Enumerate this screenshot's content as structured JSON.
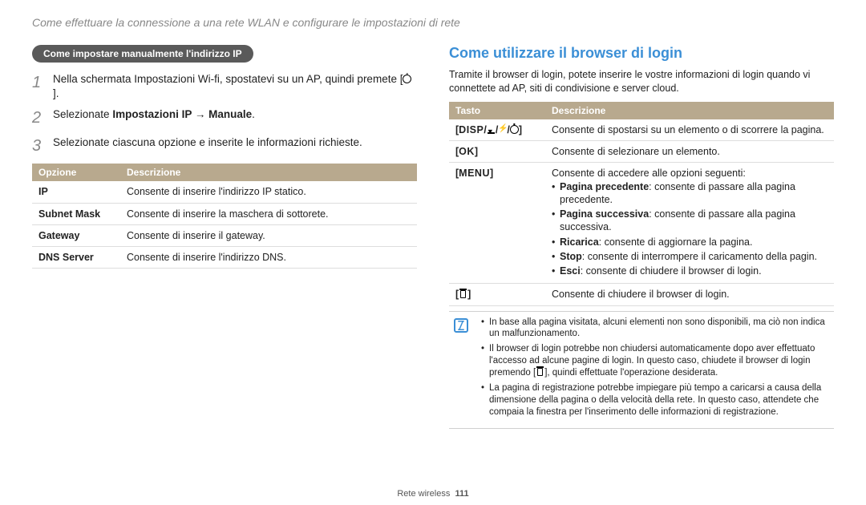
{
  "chapter_title": "Come effettuare la connessione a una rete WLAN e configurare le impostazioni di rete",
  "left": {
    "subheading": "Come impostare manualmente l'indirizzo IP",
    "step1_a": "Nella schermata Impostazioni Wi-fi, spostatevi su un AP, quindi premete [",
    "step1_b": "].",
    "step2_a": "Selezionate ",
    "step2_b": "Impostazioni IP → Manuale",
    "step2_c": ".",
    "step3": "Selezionate ciascuna opzione e inserite le informazioni richieste.",
    "table_h1": "Opzione",
    "table_h2": "Descrizione",
    "rows": [
      {
        "k": "IP",
        "v": "Consente di inserire l'indirizzo IP statico."
      },
      {
        "k": "Subnet Mask",
        "v": "Consente di inserire la maschera di sottorete."
      },
      {
        "k": "Gateway",
        "v": "Consente di inserire il gateway."
      },
      {
        "k": "DNS Server",
        "v": "Consente di inserire l'indirizzo DNS."
      }
    ]
  },
  "right": {
    "section_title": "Come utilizzare il browser di login",
    "intro": "Tramite il browser di login, potete inserire le vostre informazioni di login quando vi connettete ad AP, siti di condivisione e server cloud.",
    "table_h1": "Tasto",
    "table_h2": "Descrizione",
    "row_nav_key": "DISP",
    "row_nav_desc": "Consente di spostarsi su un elemento o di scorrere la pagina.",
    "row_ok_key": "OK",
    "row_ok_desc": "Consente di selezionare un elemento.",
    "row_menu_key": "MENU",
    "row_menu_intro": "Consente di accedere alle opzioni seguenti:",
    "row_menu_items": [
      {
        "b": "Pagina precedente",
        "t": ": consente di passare alla pagina precedente."
      },
      {
        "b": "Pagina successiva",
        "t": ": consente di passare alla pagina successiva."
      },
      {
        "b": "Ricarica",
        "t": ": consente di aggiornare la pagina."
      },
      {
        "b": "Stop",
        "t": ": consente di interrompere il caricamento della pagin."
      },
      {
        "b": "Esci",
        "t": ": consente di chiudere il browser di login."
      }
    ],
    "row_trash_desc": "Consente di chiudere il browser di login.",
    "notes": {
      "n1": "In base alla pagina visitata, alcuni elementi non sono disponibili, ma ciò non indica un malfunzionamento.",
      "n2a": "Il browser di login potrebbe non chiudersi automaticamente dopo aver effettuato l'accesso ad alcune pagine di login. In questo caso, chiudete il browser di login premendo [",
      "n2b": "], quindi effettuate l'operazione desiderata.",
      "n3": "La pagina di registrazione potrebbe impiegare più tempo a caricarsi a causa della dimensione della pagina o della velocità della rete. In questo caso, attendete che compaia la finestra per l'inserimento delle informazioni di registrazione."
    }
  },
  "footer_label": "Rete wireless",
  "footer_page": "111"
}
